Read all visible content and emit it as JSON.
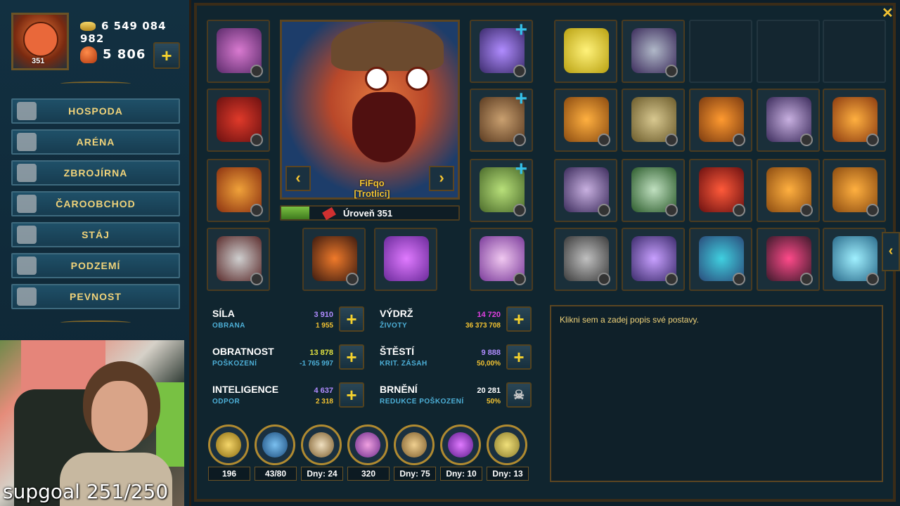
{
  "player": {
    "level_badge": "351",
    "gold": "6 549 084 982",
    "mushrooms": "5 806"
  },
  "menu": [
    {
      "label": "HOSPODA",
      "icon": "beer-mug-icon"
    },
    {
      "label": "ARÉNA",
      "icon": "arena-icon"
    },
    {
      "label": "ZBROJÍRNA",
      "icon": "weapon-shop-icon"
    },
    {
      "label": "ČAROOBCHOD",
      "icon": "magic-shop-icon"
    },
    {
      "label": "STÁJ",
      "icon": "stable-icon"
    },
    {
      "label": "PODZEMÍ",
      "icon": "dungeon-icon"
    },
    {
      "label": "PEVNOST",
      "icon": "fortress-icon"
    }
  ],
  "stream": {
    "overlay_text": "supgoal 251/250"
  },
  "character": {
    "name_line1": "FiFqo",
    "name_line2": "[Trotlici]",
    "level_text": "Úroveň 351",
    "level_progress": 0.16
  },
  "stats": [
    {
      "name": "SÍLA",
      "sub": "OBRANA",
      "v1": "3 910",
      "v2": "1 955",
      "color": "#b08cff"
    },
    {
      "name": "VÝDRŽ",
      "sub": "ŽIVOTY",
      "v1": "14 720",
      "v2": "36 373 708",
      "color": "#e040e0"
    },
    {
      "name": "OBRATNOST",
      "sub": "POŠKOZENÍ",
      "v1": "13 878",
      "v2": "-1 765 997",
      "color": "#e0e040"
    },
    {
      "name": "ŠTĚSTÍ",
      "sub": "KRIT. ZÁSAH",
      "v1": "9 888",
      "v2": "50,00%",
      "color": "#b08cff"
    },
    {
      "name": "INTELIGENCE",
      "sub": "ODPOR",
      "v1": "4 637",
      "v2": "2 318",
      "color": "#b08cff"
    },
    {
      "name": "BRNĚNÍ",
      "sub": "REDUKCE POŠKOZENÍ",
      "v1": "20 281",
      "v2": "50%",
      "color": "#ffffff"
    }
  ],
  "badges": [
    {
      "label": "196",
      "icon": "laurel-wreath-icon"
    },
    {
      "label": "43/80",
      "icon": "book-icon"
    },
    {
      "label": "Dny: 24",
      "icon": "eagle-icon"
    },
    {
      "label": "320",
      "icon": "treasure-icon"
    },
    {
      "label": "Dny: 75",
      "icon": "scroll-icon"
    },
    {
      "label": "Dny: 10",
      "icon": "purple-potion-icon"
    },
    {
      "label": "Dny: 13",
      "icon": "yellow-potion-icon"
    }
  ],
  "description": {
    "placeholder": "Klikni sem a zadej popis své postavy."
  },
  "colors": {
    "accent": "#f1c232",
    "panel": "#10252f",
    "border": "#5b4522"
  }
}
